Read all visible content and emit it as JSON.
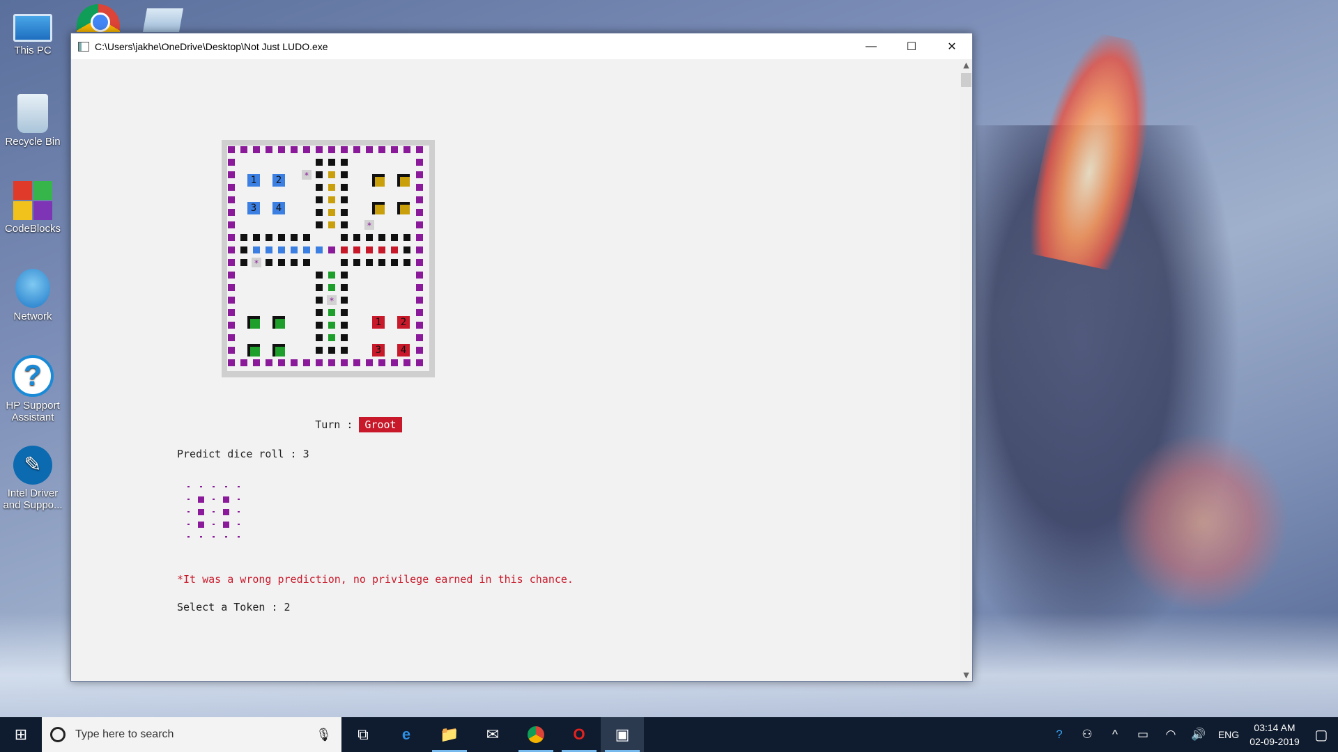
{
  "desktop": {
    "icons": [
      {
        "label": "This PC"
      },
      {
        "label": "Recycle Bin"
      },
      {
        "label": "CodeBlocks"
      },
      {
        "label": "Network"
      },
      {
        "label": "HP Support Assistant"
      },
      {
        "label": "Intel Driver and Suppo..."
      }
    ]
  },
  "window": {
    "title": "C:\\Users\\jakhe\\OneDrive\\Desktop\\Not Just LUDO.exe",
    "minimize": "—",
    "maximize": "☐",
    "close": "✕"
  },
  "board": {
    "tokens": {
      "blue": [
        "1",
        "2",
        "3",
        "4"
      ],
      "red": [
        "1",
        "2",
        "3",
        "4"
      ]
    },
    "star": "*",
    "colors": {
      "border": "#8b1a9b",
      "blue": "#3b7fe3",
      "yellow": "#c9a00c",
      "green": "#1e9e2a",
      "red": "#c8192a",
      "path": "#111111"
    }
  },
  "console": {
    "turn_label": "Turn :",
    "turn_player": "Groot",
    "predict_line": "Predict dice roll : 3",
    "warning": "*It was a wrong prediction, no privilege earned in this chance.",
    "select_line": "Select a Token : 2"
  },
  "taskbar": {
    "search_placeholder": "Type here to search",
    "language": "ENG",
    "time": "03:14 AM",
    "date": "02-09-2019"
  }
}
